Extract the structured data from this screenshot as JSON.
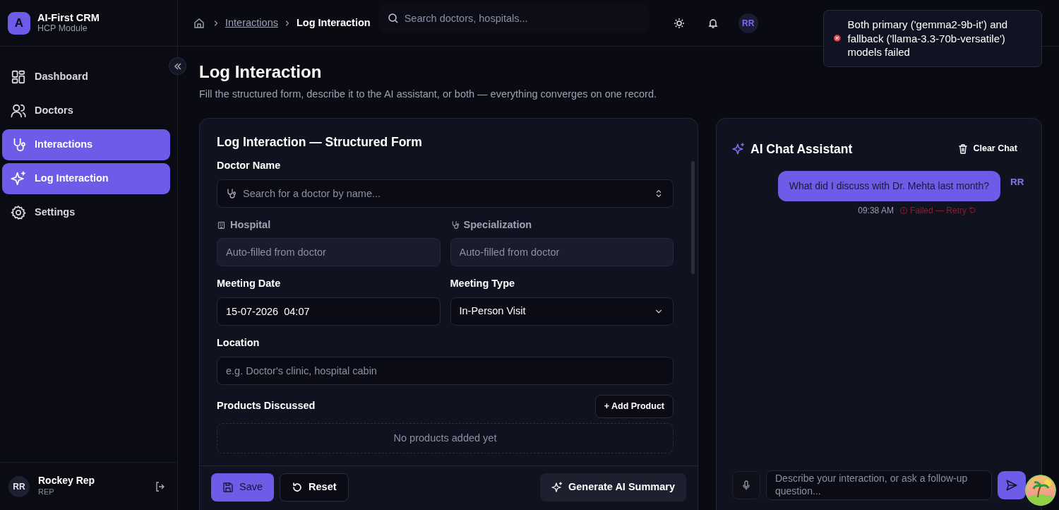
{
  "app": {
    "logo_letter": "A",
    "title": "AI-First CRM",
    "subtitle": "HCP Module"
  },
  "sidebar": {
    "items": [
      {
        "label": "Dashboard",
        "selected": false
      },
      {
        "label": "Doctors",
        "selected": false
      },
      {
        "label": "Interactions",
        "selected": true
      },
      {
        "label": "Log Interaction",
        "selected": true
      },
      {
        "label": "Settings",
        "selected": false
      }
    ],
    "user": {
      "initials": "RR",
      "name": "Rockey Rep",
      "role": "REP"
    }
  },
  "breadcrumb": [
    "Interactions",
    "Log Interaction"
  ],
  "search": {
    "placeholder": "Search doctors, hospitals..."
  },
  "header_avatar": "RR",
  "toast": {
    "kind": "error",
    "message": "Both primary ('gemma2-9b-it') and fallback ('llama-3.3-70b-versatile') models failed"
  },
  "page": {
    "title": "Log Interaction",
    "subtitle": "Fill the structured form, describe it to the AI assistant, or both — everything converges on one record."
  },
  "form": {
    "title": "Log Interaction — Structured Form",
    "doctor": {
      "label": "Doctor Name",
      "placeholder": "Search for a doctor by name..."
    },
    "hospital": {
      "label": "Hospital",
      "placeholder": "Auto-filled from doctor"
    },
    "specialization": {
      "label": "Specialization",
      "placeholder": "Auto-filled from doctor"
    },
    "meeting_date": {
      "label": "Meeting Date",
      "value": "15-07-2026  04:07"
    },
    "meeting_type": {
      "label": "Meeting Type",
      "value": "In-Person Visit"
    },
    "location": {
      "label": "Location",
      "placeholder": "e.g. Doctor's clinic, hospital cabin"
    },
    "products": {
      "label": "Products Discussed",
      "add_button": "+ Add Product",
      "empty_text": "No products added yet"
    },
    "actions": {
      "save": "Save",
      "reset": "Reset",
      "generate": "Generate AI Summary"
    }
  },
  "chat": {
    "title": "AI Chat Assistant",
    "clear_label": "Clear Chat",
    "messages": [
      {
        "kind": "user",
        "initials": "RR",
        "text": "What did I discuss with Dr. Mehta last month?",
        "time": "09:38 AM",
        "failed": true,
        "status_text": "Failed — Retry"
      }
    ],
    "input": {
      "placeholder": "Describe your interaction, or ask a follow-up question..."
    }
  }
}
